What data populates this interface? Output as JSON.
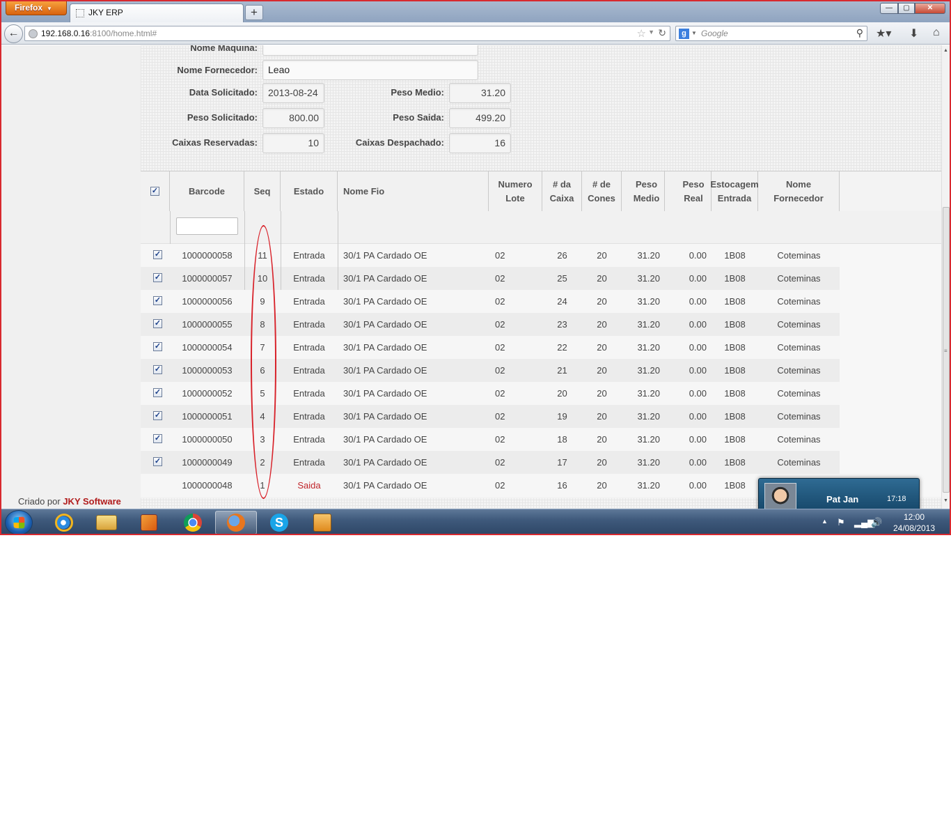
{
  "browser": {
    "app_button": "Firefox",
    "tab_title": "JKY ERP",
    "url_host": "192.168.0.16",
    "url_rest": ":8100/home.html#",
    "search_placeholder": "Google"
  },
  "form": {
    "nome_maquina_label": "Nome Maquina:",
    "nome_maquina_value": "",
    "nome_fornecedor_label": "Nome Fornecedor:",
    "nome_fornecedor_value": "Leao",
    "data_solicitado_label": "Data Solicitado:",
    "data_solicitado_value": "2013-08-24",
    "peso_solicitado_label": "Peso Solicitado:",
    "peso_solicitado_value": "800.00",
    "caixas_reservadas_label": "Caixas Reservadas:",
    "caixas_reservadas_value": "10",
    "peso_medio_label": "Peso Medio:",
    "peso_medio_value": "31.20",
    "peso_saida_label": "Peso Saida:",
    "peso_saida_value": "499.20",
    "caixas_despachado_label": "Caixas Despachado:",
    "caixas_despachado_value": "16"
  },
  "grid": {
    "headers": [
      "Barcode",
      "Seq",
      "Estado",
      "Nome Fio",
      "Numero Lote",
      "# da Caixa",
      "# de Cones",
      "Peso Medio",
      "Peso Real",
      "Estocagem Entrada",
      "Nome Fornecedor"
    ],
    "rows": [
      {
        "checked": true,
        "barcode": "1000000058",
        "seq": "11",
        "estado": "Entrada",
        "nome_fio": "30/1 PA Cardado OE",
        "lote": "02",
        "caixa": "26",
        "cones": "20",
        "peso_medio": "31.20",
        "peso_real": "0.00",
        "estocagem": "1B08",
        "fornecedor": "Coteminas"
      },
      {
        "checked": true,
        "barcode": "1000000057",
        "seq": "10",
        "estado": "Entrada",
        "nome_fio": "30/1 PA Cardado OE",
        "lote": "02",
        "caixa": "25",
        "cones": "20",
        "peso_medio": "31.20",
        "peso_real": "0.00",
        "estocagem": "1B08",
        "fornecedor": "Coteminas"
      },
      {
        "checked": true,
        "barcode": "1000000056",
        "seq": "9",
        "estado": "Entrada",
        "nome_fio": "30/1 PA Cardado OE",
        "lote": "02",
        "caixa": "24",
        "cones": "20",
        "peso_medio": "31.20",
        "peso_real": "0.00",
        "estocagem": "1B08",
        "fornecedor": "Coteminas"
      },
      {
        "checked": true,
        "barcode": "1000000055",
        "seq": "8",
        "estado": "Entrada",
        "nome_fio": "30/1 PA Cardado OE",
        "lote": "02",
        "caixa": "23",
        "cones": "20",
        "peso_medio": "31.20",
        "peso_real": "0.00",
        "estocagem": "1B08",
        "fornecedor": "Coteminas"
      },
      {
        "checked": true,
        "barcode": "1000000054",
        "seq": "7",
        "estado": "Entrada",
        "nome_fio": "30/1 PA Cardado OE",
        "lote": "02",
        "caixa": "22",
        "cones": "20",
        "peso_medio": "31.20",
        "peso_real": "0.00",
        "estocagem": "1B08",
        "fornecedor": "Coteminas"
      },
      {
        "checked": true,
        "barcode": "1000000053",
        "seq": "6",
        "estado": "Entrada",
        "nome_fio": "30/1 PA Cardado OE",
        "lote": "02",
        "caixa": "21",
        "cones": "20",
        "peso_medio": "31.20",
        "peso_real": "0.00",
        "estocagem": "1B08",
        "fornecedor": "Coteminas"
      },
      {
        "checked": true,
        "barcode": "1000000052",
        "seq": "5",
        "estado": "Entrada",
        "nome_fio": "30/1 PA Cardado OE",
        "lote": "02",
        "caixa": "20",
        "cones": "20",
        "peso_medio": "31.20",
        "peso_real": "0.00",
        "estocagem": "1B08",
        "fornecedor": "Coteminas"
      },
      {
        "checked": true,
        "barcode": "1000000051",
        "seq": "4",
        "estado": "Entrada",
        "nome_fio": "30/1 PA Cardado OE",
        "lote": "02",
        "caixa": "19",
        "cones": "20",
        "peso_medio": "31.20",
        "peso_real": "0.00",
        "estocagem": "1B08",
        "fornecedor": "Coteminas"
      },
      {
        "checked": true,
        "barcode": "1000000050",
        "seq": "3",
        "estado": "Entrada",
        "nome_fio": "30/1 PA Cardado OE",
        "lote": "02",
        "caixa": "18",
        "cones": "20",
        "peso_medio": "31.20",
        "peso_real": "0.00",
        "estocagem": "1B08",
        "fornecedor": "Coteminas"
      },
      {
        "checked": true,
        "barcode": "1000000049",
        "seq": "2",
        "estado": "Entrada",
        "nome_fio": "30/1 PA Cardado OE",
        "lote": "02",
        "caixa": "17",
        "cones": "20",
        "peso_medio": "31.20",
        "peso_real": "0.00",
        "estocagem": "1B08",
        "fornecedor": "Coteminas"
      },
      {
        "checked": false,
        "barcode": "1000000048",
        "seq": "1",
        "estado": "Saida",
        "nome_fio": "30/1 PA Cardado OE",
        "lote": "02",
        "caixa": "16",
        "cones": "20",
        "peso_medio": "31.20",
        "peso_real": "0.00",
        "estocagem": "1B08",
        "fornecedor": ""
      }
    ]
  },
  "footer": {
    "credits_prefix": "Criado por",
    "credits_brand": "JKY Software"
  },
  "skype_popup": {
    "name": "Pat Jan",
    "time": "17:18"
  },
  "taskbar": {
    "clock_time": "12:00",
    "clock_date": "24/08/2013"
  },
  "colors": {
    "annotation_circle": "#d8222a",
    "saida_text": "#c0262b",
    "brand_red": "#b11b1b"
  }
}
